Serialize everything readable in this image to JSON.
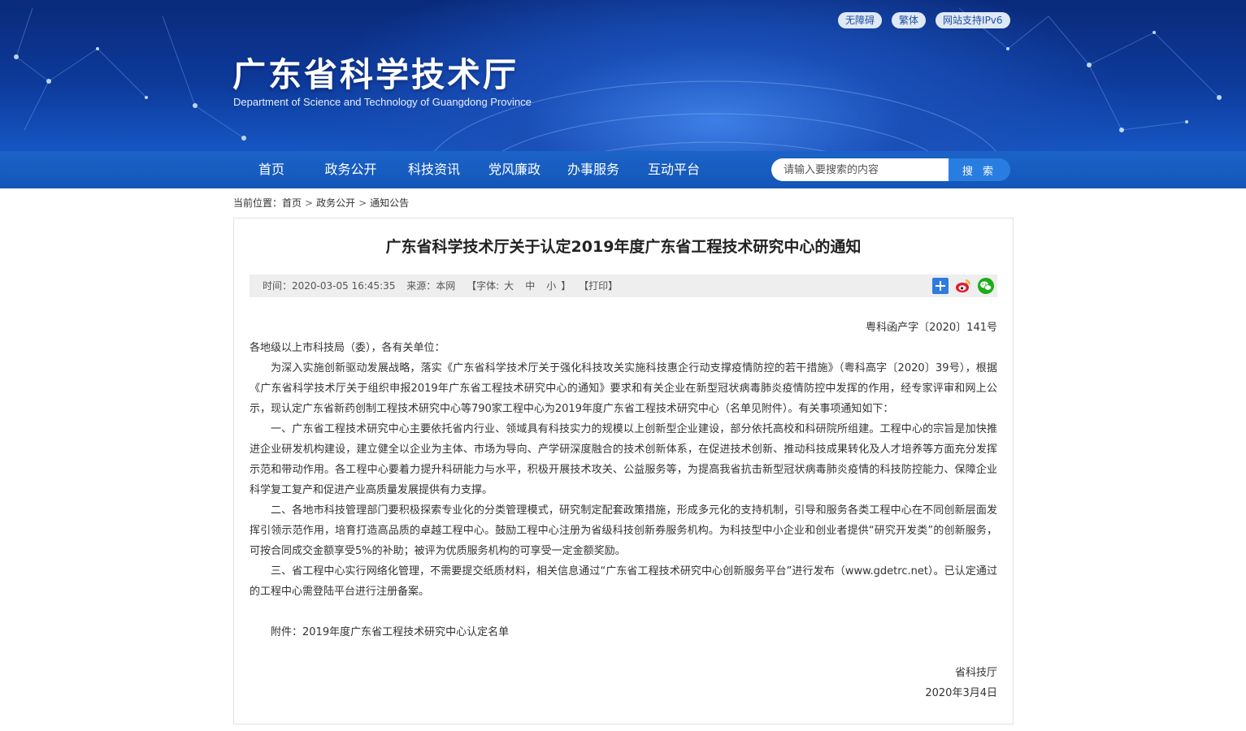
{
  "header": {
    "top_links": [
      "无障碍",
      "繁体",
      "网站支持IPv6"
    ],
    "title": "广东省科学技术厅",
    "subtitle": "Department of Science and Technology of Guangdong Province"
  },
  "nav": {
    "items": [
      "首页",
      "政务公开",
      "科技资讯",
      "党风廉政",
      "办事服务",
      "互动平台"
    ],
    "search_placeholder": "请输入要搜索的内容",
    "search_button": "搜 索"
  },
  "breadcrumb": {
    "label": "当前位置：",
    "items": [
      "首页",
      "政务公开",
      "通知公告"
    ],
    "separator": ">"
  },
  "article": {
    "title": "广东省科学技术厅关于认定2019年度广东省工程技术研究中心的通知",
    "meta": {
      "time": "时间：2020-03-05 16:45:35",
      "source": "来源：本网",
      "font_prefix": "【字体:",
      "font_options": [
        "大",
        "中",
        "小"
      ],
      "font_suffix": "】",
      "print": "【打印】"
    },
    "doc_number": "粤科函产字〔2020〕141号",
    "salutation": "各地级以上市科技局（委），各有关单位：",
    "paragraphs": [
      "为深入实施创新驱动发展战略，落实《广东省科学技术厅关于强化科技攻关实施科技惠企行动支撑疫情防控的若干措施》（粤科高字〔2020〕39号），根据《广东省科学技术厅关于组织申报2019年广东省工程技术研究中心的通知》要求和有关企业在新型冠状病毒肺炎疫情防控中发挥的作用，经专家评审和网上公示，现认定广东省新药创制工程技术研究中心等790家工程中心为2019年度广东省工程技术研究中心（名单见附件）。有关事项通知如下：",
      "一、广东省工程技术研究中心主要依托省内行业、领域具有科技实力的规模以上创新型企业建设，部分依托高校和科研院所组建。工程中心的宗旨是加快推进企业研发机构建设，建立健全以企业为主体、市场为导向、产学研深度融合的技术创新体系，在促进技术创新、推动科技成果转化及人才培养等方面充分发挥示范和带动作用。各工程中心要着力提升科研能力与水平，积极开展技术攻关、公益服务等，为提高我省抗击新型冠状病毒肺炎疫情的科技防控能力、保障企业科学复工复产和促进产业高质量发展提供有力支撑。",
      "二、各地市科技管理部门要积极探索专业化的分类管理模式，研究制定配套政策措施，形成多元化的支持机制，引导和服务各类工程中心在不同创新层面发挥引领示范作用，培育打造高品质的卓越工程中心。鼓励工程中心注册为省级科技创新券服务机构。为科技型中小企业和创业者提供“研究开发类”的创新服务，可按合同成交金额享受5%的补助；被评为优质服务机构的可享受一定金额奖励。",
      "三、省工程中心实行网络化管理，不需要提交纸质材料，相关信息通过“广东省工程技术研究中心创新服务平台”进行发布（www.gdetrc.net）。已认定通过的工程中心需登陆平台进行注册备案。"
    ],
    "attachment": "附件：2019年度广东省工程技术研究中心认定名单",
    "signature": "省科技厅",
    "date": "2020年3月4日"
  },
  "colors": {
    "nav_bg": "#1456b8",
    "search_button": "#2a7de0",
    "banner_dark": "#0a2a7a"
  },
  "icons": [
    "share-plus-icon",
    "weibo-icon",
    "wechat-icon"
  ]
}
